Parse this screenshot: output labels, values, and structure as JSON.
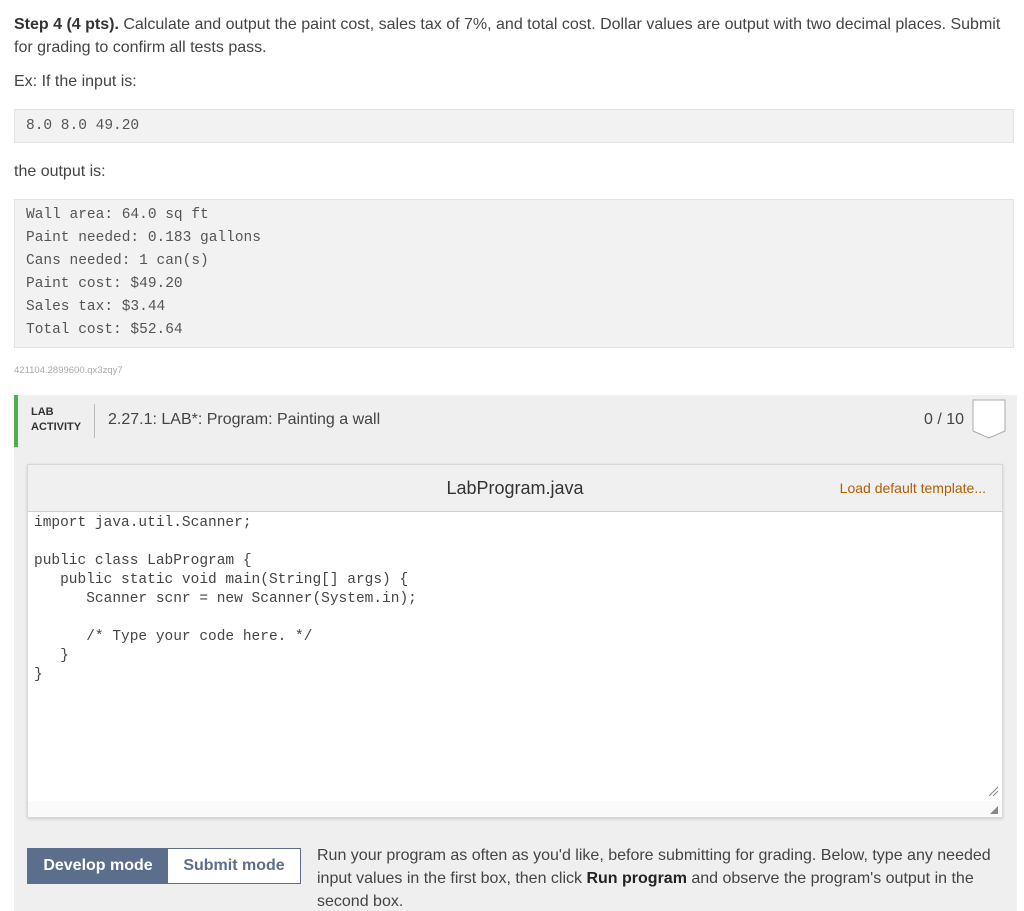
{
  "instructions": {
    "step_label": "Step 4 (4 pts).",
    "step_text": " Calculate and output the paint cost, sales tax of 7%, and total cost. Dollar values are output with two decimal places. Submit for grading to confirm all tests pass.",
    "example_intro": "Ex: If the input is:",
    "example_input": [
      "8.0 8.0 49.20"
    ],
    "output_intro": "the output is:",
    "example_output": [
      "Wall area: 64.0 sq ft",
      "Paint needed: 0.183 gallons",
      "Cans needed: 1 can(s)",
      "Paint cost: $49.20",
      "Sales tax: $3.44",
      "Total cost: $52.64"
    ],
    "activity_id": "421104.2899600.qx3zqy7"
  },
  "lab": {
    "badge_line1": "LAB",
    "badge_line2": "ACTIVITY",
    "title": "2.27.1: LAB*: Program: Painting a wall",
    "score": "0 / 10",
    "accent_color": "#4caf50"
  },
  "editor": {
    "filename": "LabProgram.java",
    "load_template": "Load default template...",
    "code_lines": [
      "import java.util.Scanner;",
      "",
      "public class LabProgram {",
      "   public static void main(String[] args) {",
      "      Scanner scnr = new Scanner(System.in);",
      "",
      "      /* Type your code here. */",
      "   }",
      "}"
    ]
  },
  "modes": {
    "develop": "Develop mode",
    "submit": "Submit mode",
    "active": "develop",
    "color": "#5b6f8c"
  },
  "help": {
    "part1": "Run your program as often as you'd like, before submitting for grading. Below, type any needed input values in the first box, then click ",
    "run_label": "Run program",
    "part2": " and observe the program's output in the second box."
  }
}
